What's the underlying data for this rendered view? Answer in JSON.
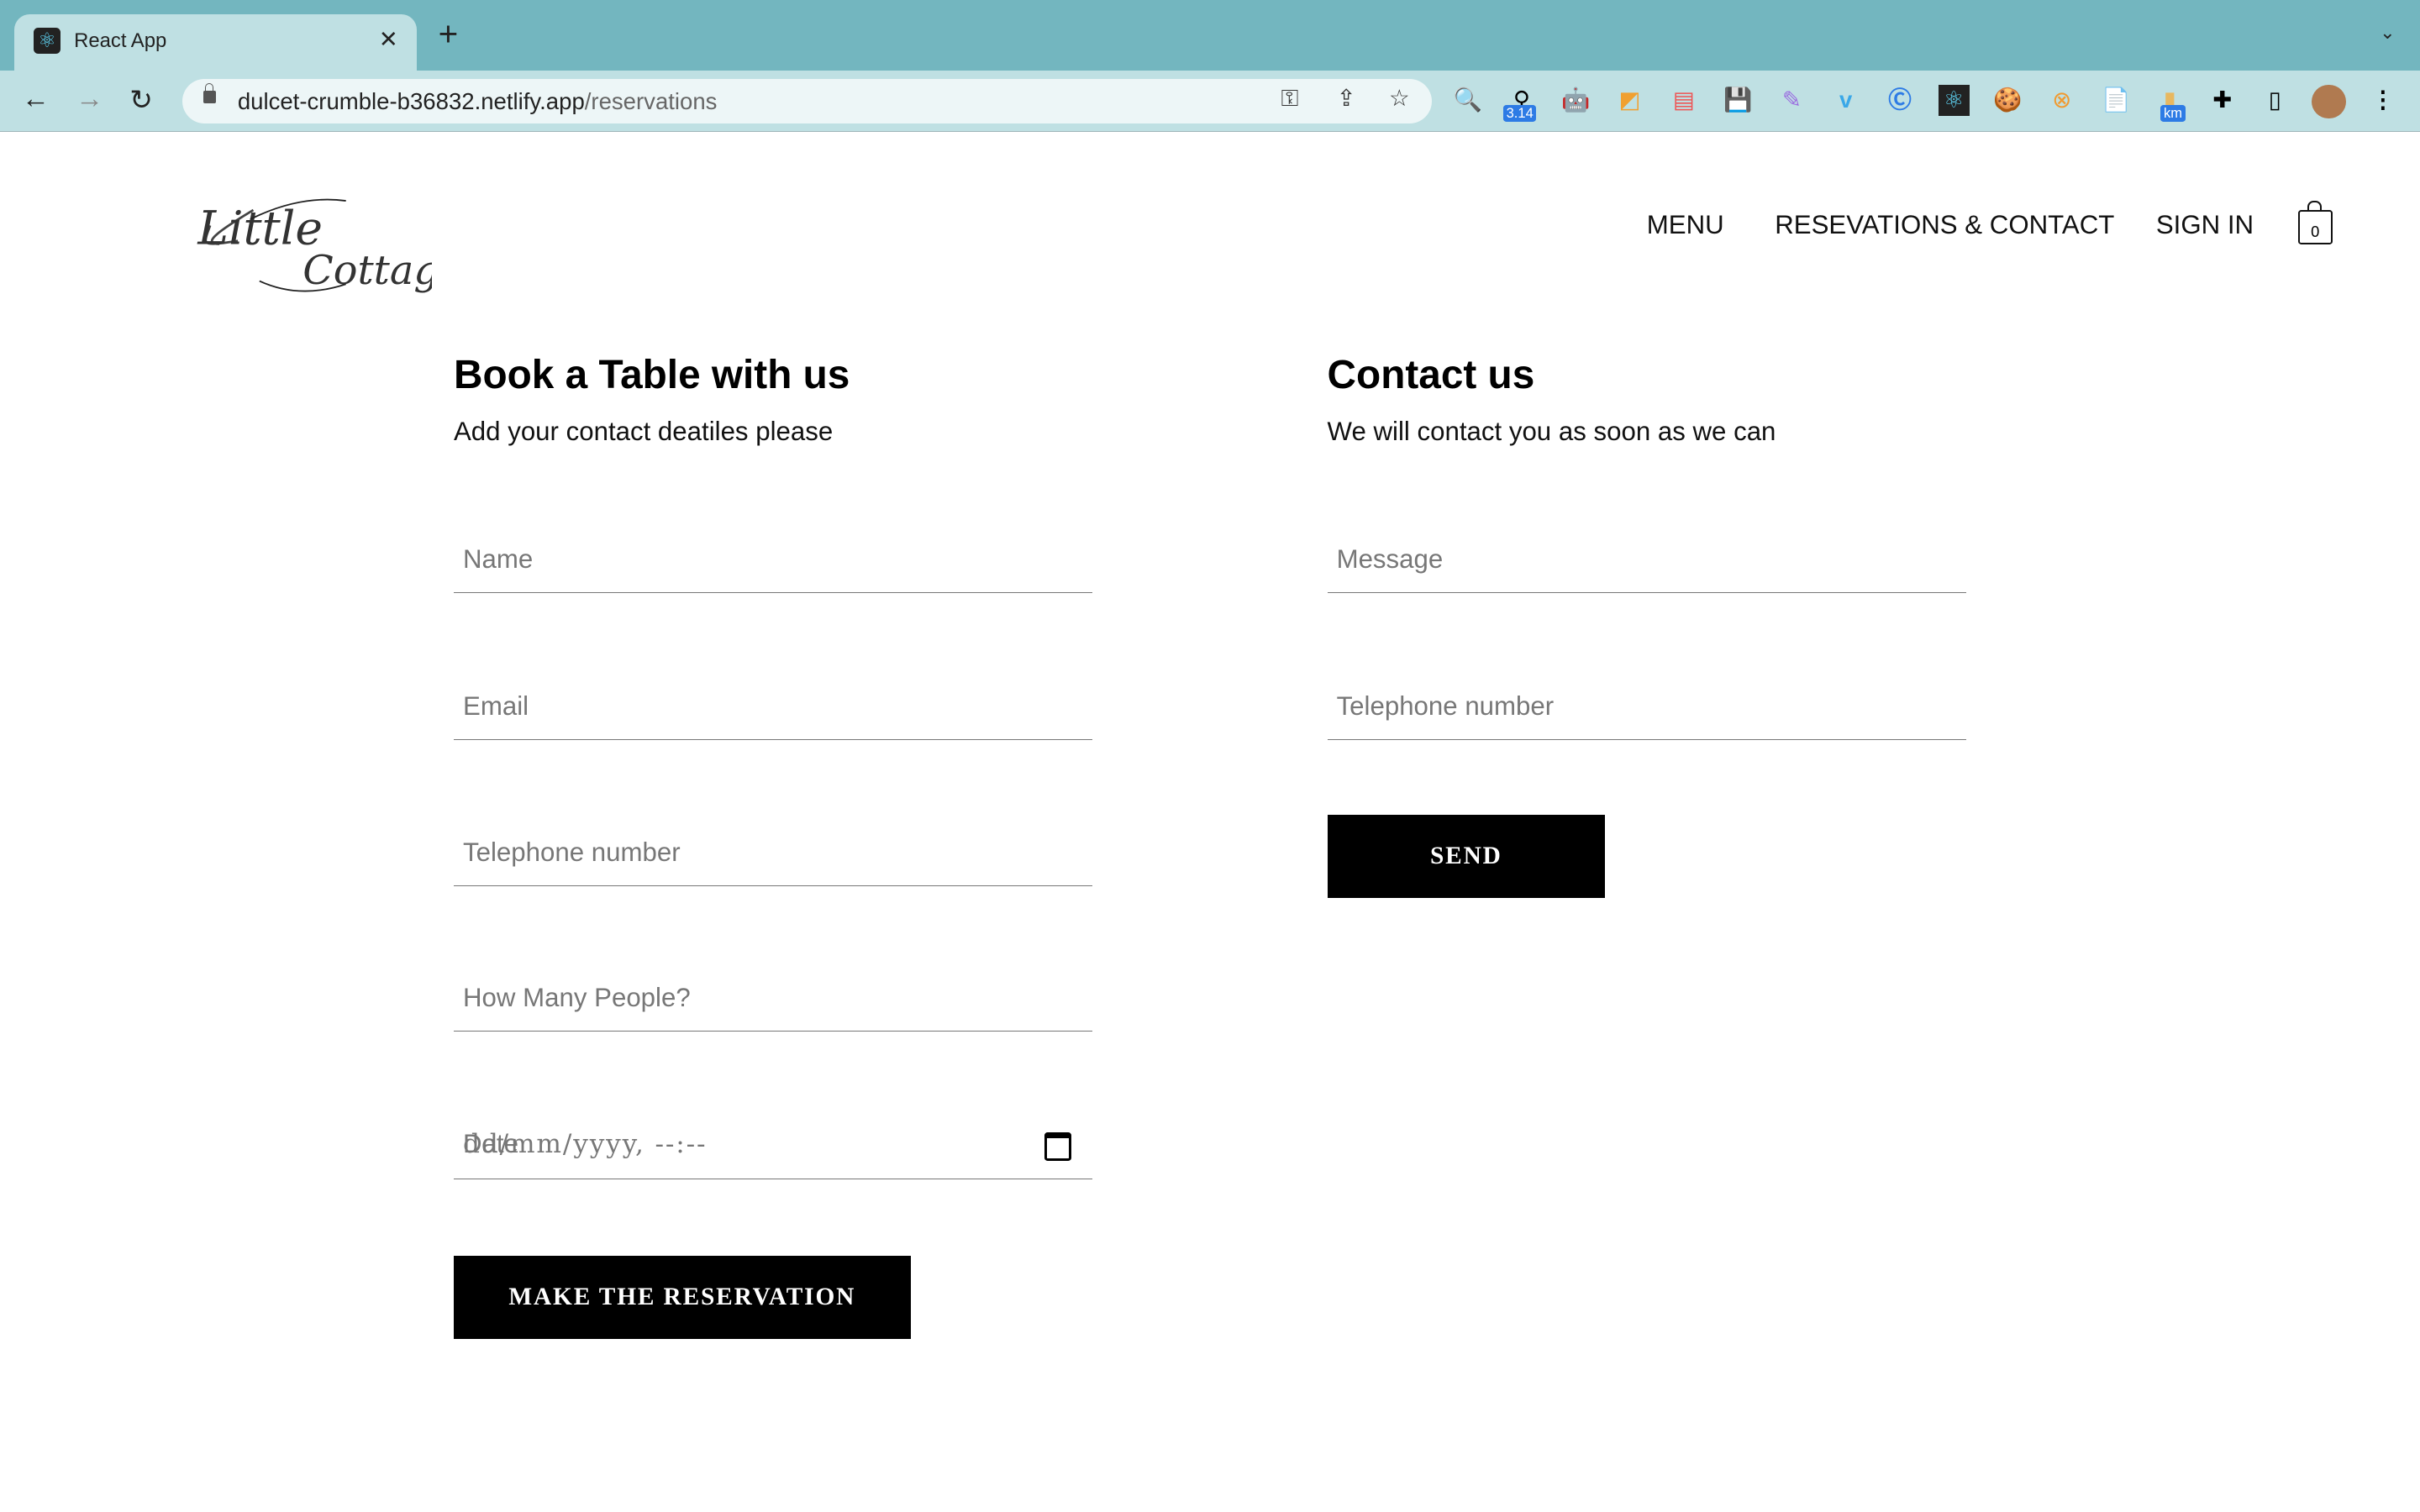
{
  "browser": {
    "tab_title": "React App",
    "url_host": "dulcet-crumble-b36832.netlify.app",
    "url_path": "/reservations",
    "extension_badges": {
      "pi": "3.14",
      "km": "km"
    }
  },
  "header": {
    "logo_text": "Little Cottage",
    "nav": [
      "MENU",
      "RESEVATIONS & CONTACT",
      "SIGN IN"
    ],
    "cart_count": "0"
  },
  "booking": {
    "title": "Book a Table with us",
    "subtitle": "Add your contact deatiles please",
    "fields": [
      "Name",
      "Email",
      "Telephone number",
      "How Many People?"
    ],
    "date_label": "Date",
    "date_placeholder": "dd/mm/yyyy, --:--",
    "submit": "MAKE THE RESERVATION"
  },
  "contact": {
    "title": "Contact us",
    "subtitle": "We will contact you as soon as we can",
    "fields": [
      "Message",
      "Telephone number"
    ],
    "submit": "SEND"
  }
}
